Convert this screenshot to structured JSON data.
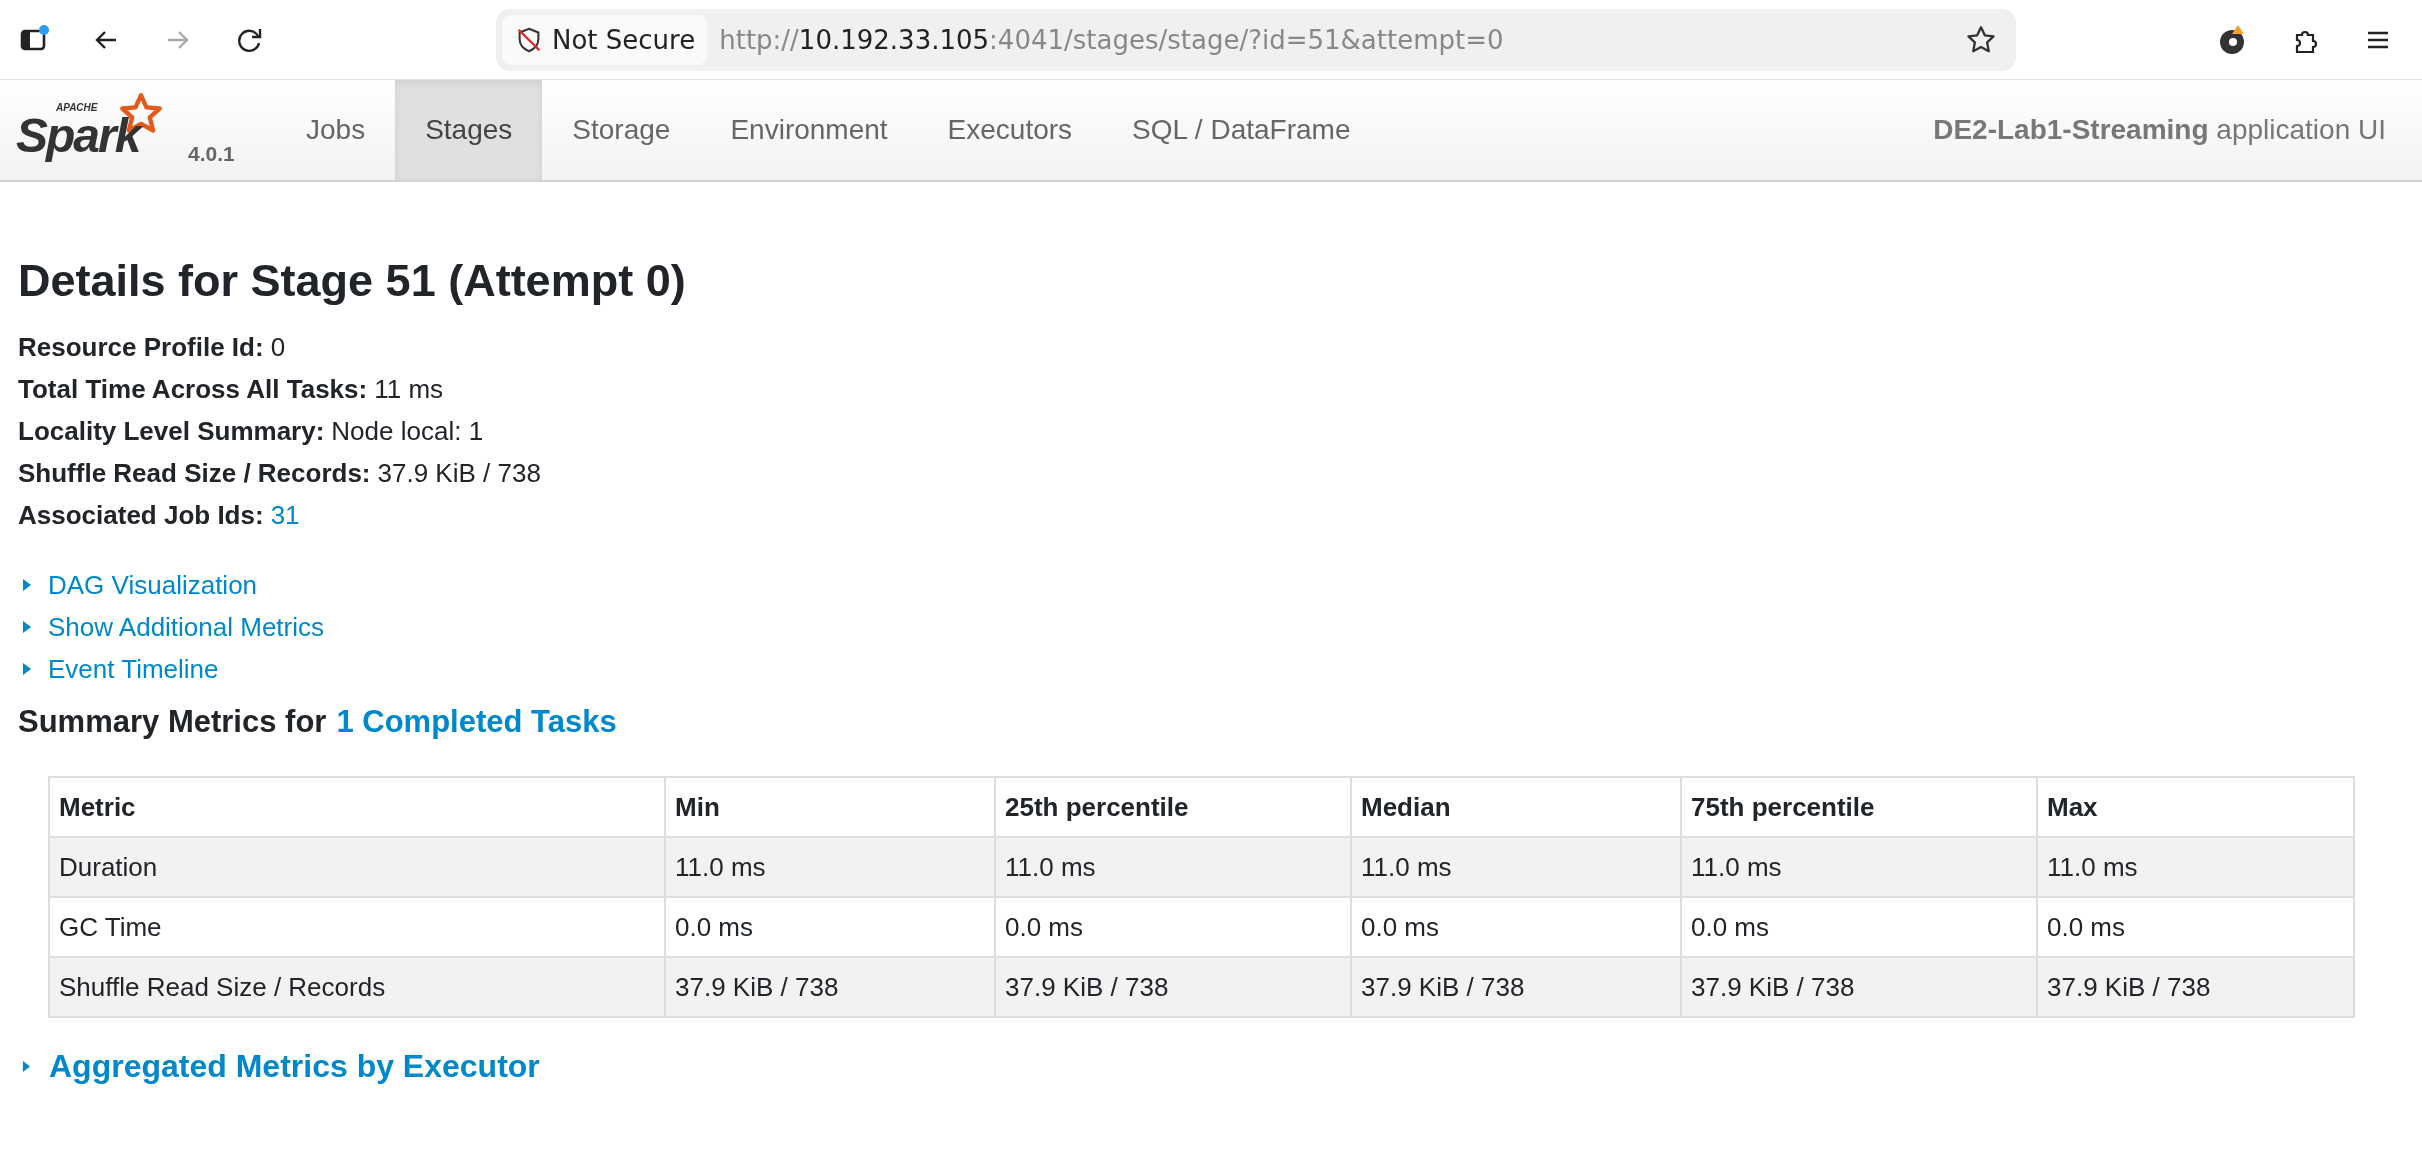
{
  "browser": {
    "security_label": "Not Secure",
    "url": {
      "scheme": "http://",
      "host": "10.192.33.105",
      "rest": ":4041/stages/stage/?id=51&attempt=0"
    }
  },
  "navbar": {
    "logo": {
      "tagline": "APACHE",
      "brand": "Spark"
    },
    "version": "4.0.1",
    "tabs": [
      {
        "label": "Jobs",
        "selected": false
      },
      {
        "label": "Stages",
        "selected": true
      },
      {
        "label": "Storage",
        "selected": false
      },
      {
        "label": "Environment",
        "selected": false
      },
      {
        "label": "Executors",
        "selected": false
      },
      {
        "label": "SQL / DataFrame",
        "selected": false
      }
    ],
    "app_name": "**DE2-Lab1-Streaming** application UI"
  },
  "title": "Details for Stage 51 (Attempt 0)",
  "details": [
    {
      "label": "Resource Profile Id:",
      "value": "0",
      "kind": "text"
    },
    {
      "label": "Total Time Across All Tasks:",
      "value": "11 ms",
      "kind": "text"
    },
    {
      "label": "Locality Level Summary:",
      "value": "Node local: 1",
      "kind": "text"
    },
    {
      "label": "Shuffle Read Size / Records:",
      "value": "37.9 KiB / 738",
      "kind": "text"
    },
    {
      "label": "Associated Job Ids:",
      "value": "31",
      "kind": "link"
    }
  ],
  "toggles": [
    {
      "label": "DAG Visualization",
      "expanded": false
    },
    {
      "label": "Show Additional Metrics",
      "expanded": false
    },
    {
      "label": "Event Timeline",
      "expanded": false
    }
  ],
  "summary": {
    "heading": "Summary Metrics for",
    "link": "1 Completed Tasks"
  },
  "table": {
    "columns": [
      "Metric",
      "Min",
      "25th percentile",
      "Median",
      "75th percentile",
      "Max"
    ],
    "rows": [
      [
        "Duration",
        "11.0 ms",
        "11.0 ms",
        "11.0 ms",
        "11.0 ms",
        "11.0 ms"
      ],
      [
        "GC Time",
        "0.0 ms",
        "0.0 ms",
        "0.0 ms",
        "0.0 ms",
        "0.0 ms"
      ],
      [
        "Shuffle Read Size / Records",
        "37.9 KiB / 738",
        "37.9 KiB / 738",
        "37.9 KiB / 738",
        "37.9 KiB / 738",
        "37.9 KiB / 738"
      ]
    ]
  },
  "aggregated": {
    "label": "Aggregated Metrics by Executor",
    "expanded": false
  }
}
